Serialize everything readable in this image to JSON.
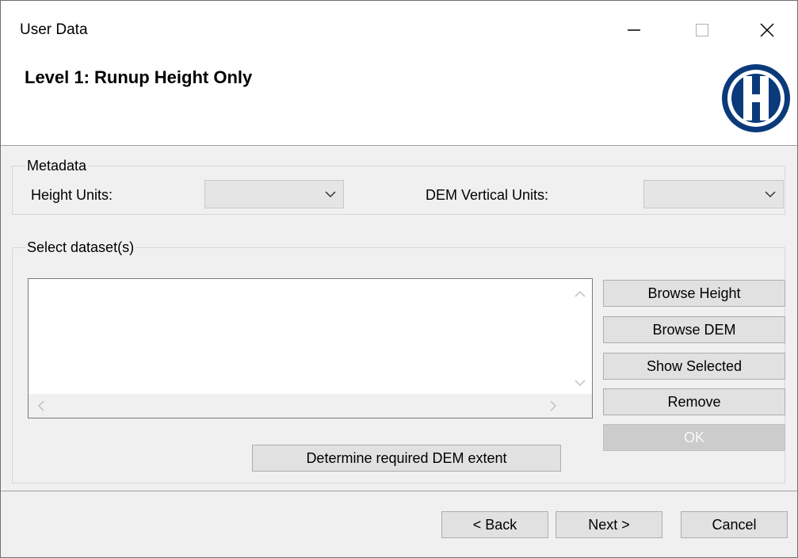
{
  "window": {
    "title": "User Data",
    "controls": [
      "minimize",
      "maximize",
      "close"
    ]
  },
  "header": {
    "title": "Level 1: Runup Height Only",
    "logo_icon": "h-circle-logo",
    "logo_color": "#0a3a7a"
  },
  "metadata": {
    "group_label": "Metadata",
    "height_units_label": "Height Units:",
    "height_units_value": "",
    "dem_vertical_units_label": "DEM Vertical Units:",
    "dem_vertical_units_value": ""
  },
  "datasets": {
    "group_label": "Select dataset(s)",
    "items": [],
    "buttons": {
      "browse_height": "Browse Height",
      "browse_dem": "Browse DEM",
      "show_selected": "Show Selected",
      "remove": "Remove",
      "ok": "OK",
      "determine_extent": "Determine required DEM extent"
    }
  },
  "footer": {
    "back": "< Back",
    "next": "Next >",
    "cancel": "Cancel"
  }
}
